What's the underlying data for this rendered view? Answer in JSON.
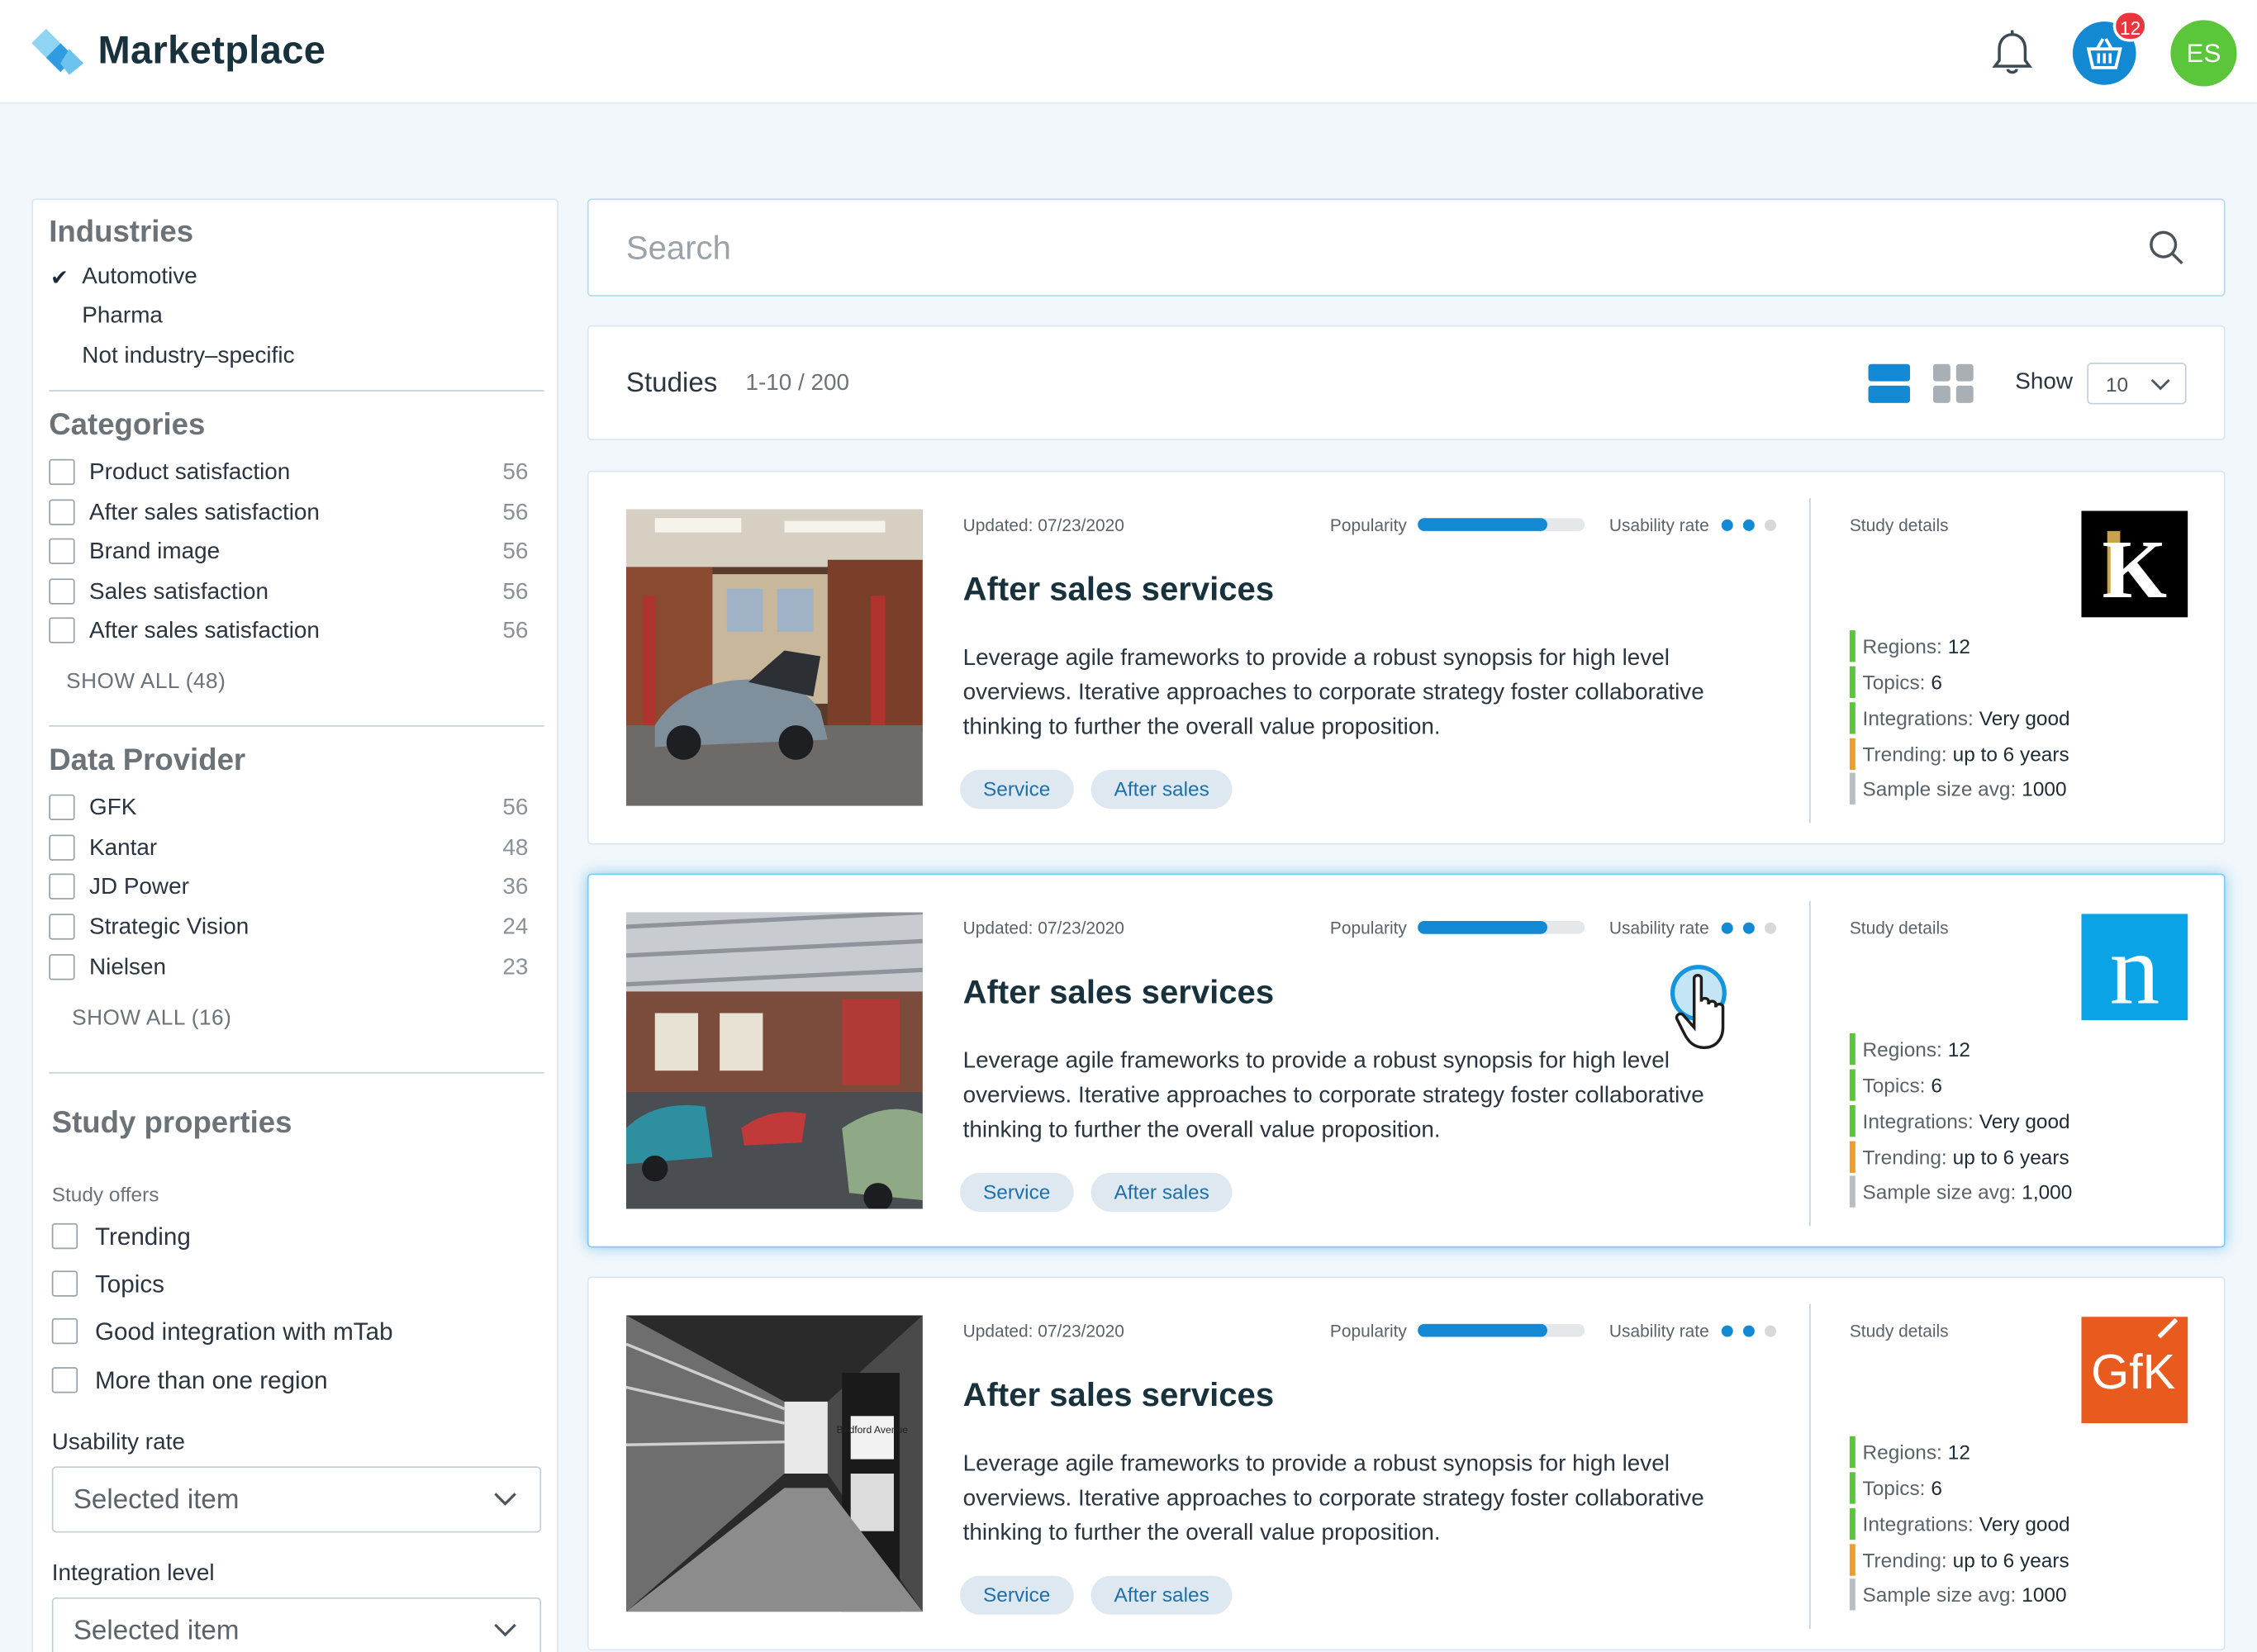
{
  "header": {
    "brand": "Marketplace",
    "cart_count": "12",
    "avatar_initials": "ES",
    "colors": {
      "accent": "#1489d3",
      "badge": "#e8363f",
      "avatar": "#5cc63a"
    }
  },
  "sidebar": {
    "industries": {
      "title": "Industries",
      "items": [
        {
          "label": "Automotive",
          "selected": true
        },
        {
          "label": "Pharma",
          "selected": false
        },
        {
          "label": "Not industry–specific",
          "selected": false
        }
      ]
    },
    "categories": {
      "title": "Categories",
      "items": [
        {
          "label": "Product satisfaction",
          "count": "56"
        },
        {
          "label": "After sales satisfaction",
          "count": "56"
        },
        {
          "label": "Brand image",
          "count": "56"
        },
        {
          "label": "Sales satisfaction",
          "count": "56"
        },
        {
          "label": "After sales satisfaction",
          "count": "56"
        }
      ],
      "show_all": "SHOW ALL (48)"
    },
    "data_provider": {
      "title": "Data Provider",
      "items": [
        {
          "label": "GFK",
          "count": "56"
        },
        {
          "label": "Kantar",
          "count": "48"
        },
        {
          "label": "JD Power",
          "count": "36"
        },
        {
          "label": "Strategic Vision",
          "count": "24"
        },
        {
          "label": "Nielsen",
          "count": "23"
        }
      ],
      "show_all": "SHOW ALL (16)"
    },
    "study_properties": {
      "title": "Study properties",
      "offers_label": "Study offers",
      "offers": [
        "Trending",
        "Topics",
        "Good integration with mTab",
        "More than one region"
      ],
      "usability_label": "Usability rate",
      "usability_value": "Selected item",
      "integration_label": "Integration level",
      "integration_value": "Selected item"
    }
  },
  "search": {
    "placeholder": "Search"
  },
  "studies_bar": {
    "title": "Studies",
    "count": "1-10 / 200",
    "show_label": "Show",
    "show_value": "10"
  },
  "studies": [
    {
      "updated": "Updated: 07/23/2020",
      "popularity_label": "Popularity",
      "popularity": 0.78,
      "usability_label": "Usability rate",
      "usability_rate": 2,
      "usability_max": 3,
      "title": "After sales services",
      "description": "Leverage agile frameworks to provide a robust synopsis for high level overviews. Iterative approaches to corporate strategy foster collaborative thinking to further the overall value proposition.",
      "tags": [
        "Service",
        "After sales"
      ],
      "details_title": "Study details",
      "provider_logo_text": "K",
      "details": [
        {
          "label": "Regions:",
          "value": "12",
          "color": "#5cc63a"
        },
        {
          "label": "Topics:",
          "value": "6",
          "color": "#5cc63a"
        },
        {
          "label": "Integrations:",
          "value": "Very good",
          "color": "#5cc63a"
        },
        {
          "label": "Trending:",
          "value": "up to 6 years",
          "color": "#f39a2b"
        },
        {
          "label": "Sample size avg:",
          "value": "1000",
          "color": "#b8bec3"
        }
      ]
    },
    {
      "updated": "Updated: 07/23/2020",
      "popularity_label": "Popularity",
      "popularity": 0.78,
      "usability_label": "Usability rate",
      "usability_rate": 2,
      "usability_max": 3,
      "title": "After sales services",
      "description": "Leverage agile frameworks to provide a robust synopsis for high level overviews. Iterative approaches to corporate strategy foster collaborative thinking to further the overall value proposition.",
      "tags": [
        "Service",
        "After sales"
      ],
      "details_title": "Study details",
      "provider_logo_text": "n",
      "details": [
        {
          "label": "Regions:",
          "value": "12",
          "color": "#5cc63a"
        },
        {
          "label": "Topics:",
          "value": "6",
          "color": "#5cc63a"
        },
        {
          "label": "Integrations:",
          "value": "Very good",
          "color": "#5cc63a"
        },
        {
          "label": "Trending:",
          "value": "up to 6 years",
          "color": "#f39a2b"
        },
        {
          "label": "Sample size avg:",
          "value": "1,000",
          "color": "#b8bec3"
        }
      ]
    },
    {
      "updated": "Updated: 07/23/2020",
      "popularity_label": "Popularity",
      "popularity": 0.78,
      "usability_label": "Usability rate",
      "usability_rate": 2,
      "usability_max": 3,
      "title": "After sales services",
      "description": "Leverage agile frameworks to provide a robust synopsis for high level overviews. Iterative approaches to corporate strategy foster collaborative thinking to further the overall value proposition.",
      "tags": [
        "Service",
        "After sales"
      ],
      "details_title": "Study details",
      "provider_logo_text": "GfK",
      "photo_sign_text": "Bedford Avenue",
      "details": [
        {
          "label": "Regions:",
          "value": "12",
          "color": "#5cc63a"
        },
        {
          "label": "Topics:",
          "value": "6",
          "color": "#5cc63a"
        },
        {
          "label": "Integrations:",
          "value": "Very good",
          "color": "#5cc63a"
        },
        {
          "label": "Trending:",
          "value": "up to 6 years",
          "color": "#f39a2b"
        },
        {
          "label": "Sample size avg:",
          "value": "1000",
          "color": "#b8bec3"
        }
      ]
    }
  ]
}
